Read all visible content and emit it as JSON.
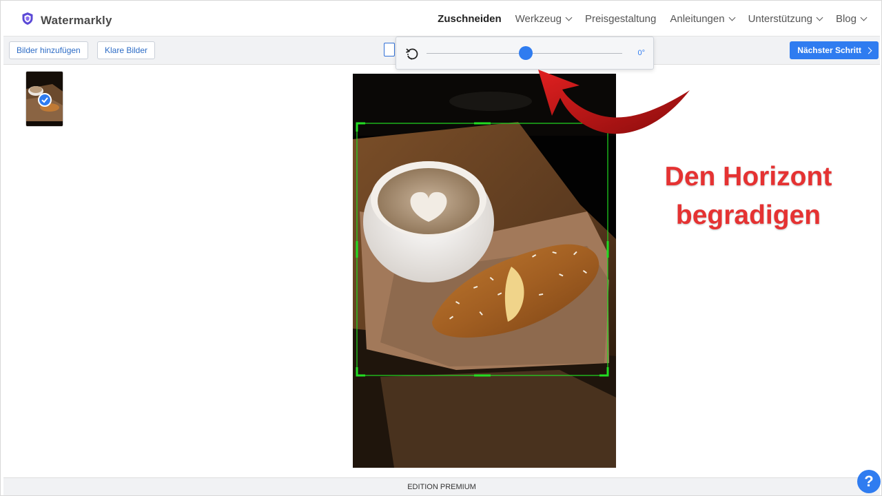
{
  "app": {
    "name": "Watermarkly"
  },
  "nav": {
    "items": [
      {
        "label": "Zuschneiden",
        "active": true,
        "dropdown": false
      },
      {
        "label": "Werkzeug",
        "active": false,
        "dropdown": true
      },
      {
        "label": "Preisgestaltung",
        "active": false,
        "dropdown": false
      },
      {
        "label": "Anleitungen",
        "active": false,
        "dropdown": true
      },
      {
        "label": "Unterstützung",
        "active": false,
        "dropdown": true
      },
      {
        "label": "Blog",
        "active": false,
        "dropdown": true
      }
    ]
  },
  "toolbar": {
    "add_label": "Bilder hinzufügen",
    "clear_label": "Klare Bilder",
    "next_label": "Nächster Schritt"
  },
  "rotate": {
    "angle_label": "0°",
    "value_fraction": 0.5
  },
  "annotation": {
    "line1": "Den Horizont",
    "line2": "begradigen",
    "color": "#e53232"
  },
  "footer": {
    "edition": "EDITION PREMIUM"
  },
  "help": {
    "label": "?"
  },
  "colors": {
    "accent": "#2f7cf0",
    "crop_frame": "#22dd22"
  }
}
